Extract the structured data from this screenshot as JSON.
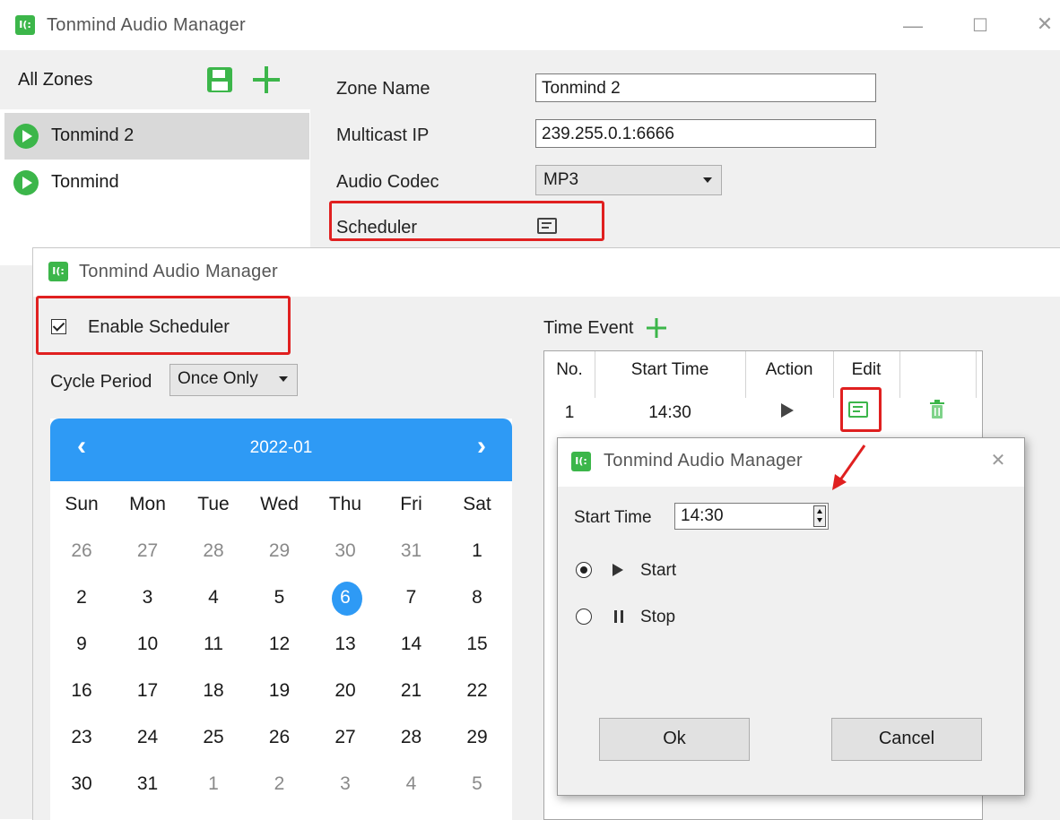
{
  "main_window": {
    "title": "Tonmind Audio Manager",
    "logo_text": "I(:",
    "minimize_glyph": "—",
    "maximize_glyph": "☐",
    "close_glyph": "✕"
  },
  "zones_panel": {
    "header_label": "All Zones",
    "items": [
      {
        "name": "Tonmind 2",
        "selected": true
      },
      {
        "name": "Tonmind",
        "selected": false
      }
    ]
  },
  "zone_form": {
    "zone_name_label": "Zone Name",
    "zone_name_value": "Tonmind 2",
    "multicast_ip_label": "Multicast IP",
    "multicast_ip_value": "239.255.0.1:6666",
    "audio_codec_label": "Audio Codec",
    "audio_codec_value": "MP3",
    "scheduler_label": "Scheduler"
  },
  "scheduler_dialog": {
    "title": "Tonmind Audio Manager",
    "enable_scheduler_label": "Enable Scheduler",
    "enable_scheduler_checked": true,
    "cycle_period_label": "Cycle Period",
    "cycle_period_value": "Once Only",
    "calendar": {
      "month_label": "2022-01",
      "prev_glyph": "‹",
      "next_glyph": "›",
      "weekdays": [
        "Sun",
        "Mon",
        "Tue",
        "Wed",
        "Thu",
        "Fri",
        "Sat"
      ],
      "weeks": [
        [
          "26",
          "27",
          "28",
          "29",
          "30",
          "31",
          "1"
        ],
        [
          "2",
          "3",
          "4",
          "5",
          "6",
          "7",
          "8"
        ],
        [
          "9",
          "10",
          "11",
          "12",
          "13",
          "14",
          "15"
        ],
        [
          "16",
          "17",
          "18",
          "19",
          "20",
          "21",
          "22"
        ],
        [
          "23",
          "24",
          "25",
          "26",
          "27",
          "28",
          "29"
        ],
        [
          "30",
          "31",
          "1",
          "2",
          "3",
          "4",
          "5"
        ]
      ],
      "selected_day": "6"
    },
    "time_event": {
      "label": "Time Event",
      "columns": [
        "No.",
        "Start Time",
        "Action",
        "Edit"
      ],
      "rows": [
        {
          "no": "1",
          "start_time": "14:30",
          "action": "start"
        }
      ]
    }
  },
  "edit_dialog": {
    "title": "Tonmind Audio Manager",
    "close_glyph": "✕",
    "start_time_label": "Start Time",
    "start_time_value": "14:30",
    "options": [
      {
        "label": "Start",
        "selected": true
      },
      {
        "label": "Stop",
        "selected": false
      }
    ],
    "ok_label": "Ok",
    "cancel_label": "Cancel"
  },
  "colors": {
    "accent_green": "#3cb64a",
    "calendar_blue": "#2e9af5",
    "highlight_red": "#e02020"
  }
}
